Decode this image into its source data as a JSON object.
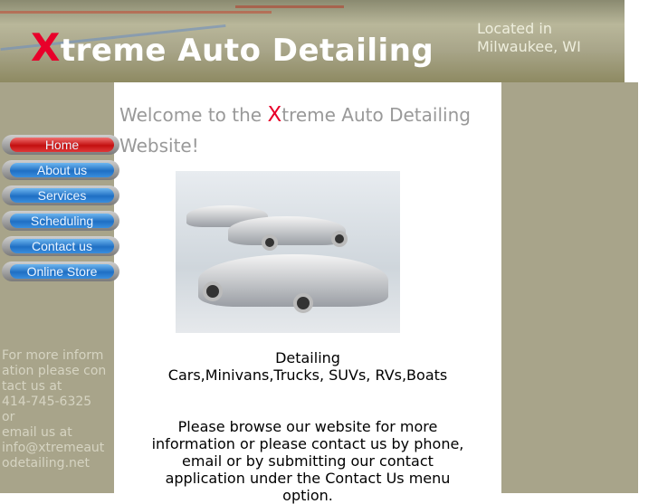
{
  "header": {
    "title_x": "X",
    "title_rest": "treme Auto Detailing",
    "location_line1": "Located in",
    "location_line2": "Milwaukee, WI"
  },
  "nav": [
    {
      "label": "Home",
      "active": true
    },
    {
      "label": "About us"
    },
    {
      "label": "Services"
    },
    {
      "label": "Scheduling"
    },
    {
      "label": "Contact us"
    },
    {
      "label": "Online Store"
    }
  ],
  "welcome": {
    "pre": "Welcome to the ",
    "x": "X",
    "post": "treme Auto Detailing Website!"
  },
  "sidebar_contact": {
    "line1": "For more information please contact us at",
    "phone": "414-745-6325",
    "or": "or",
    "email_label": "email us at",
    "email": "info@xtremeautodetailing.net"
  },
  "main": {
    "detailing_title": "Detailing",
    "detailing_list": "Cars,Minivans,Trucks, SUVs, RVs,Boats",
    "browse_text": "Please browse our website for more information or please contact us by phone, email or by submitting our contact application under the Contact Us menu option."
  }
}
